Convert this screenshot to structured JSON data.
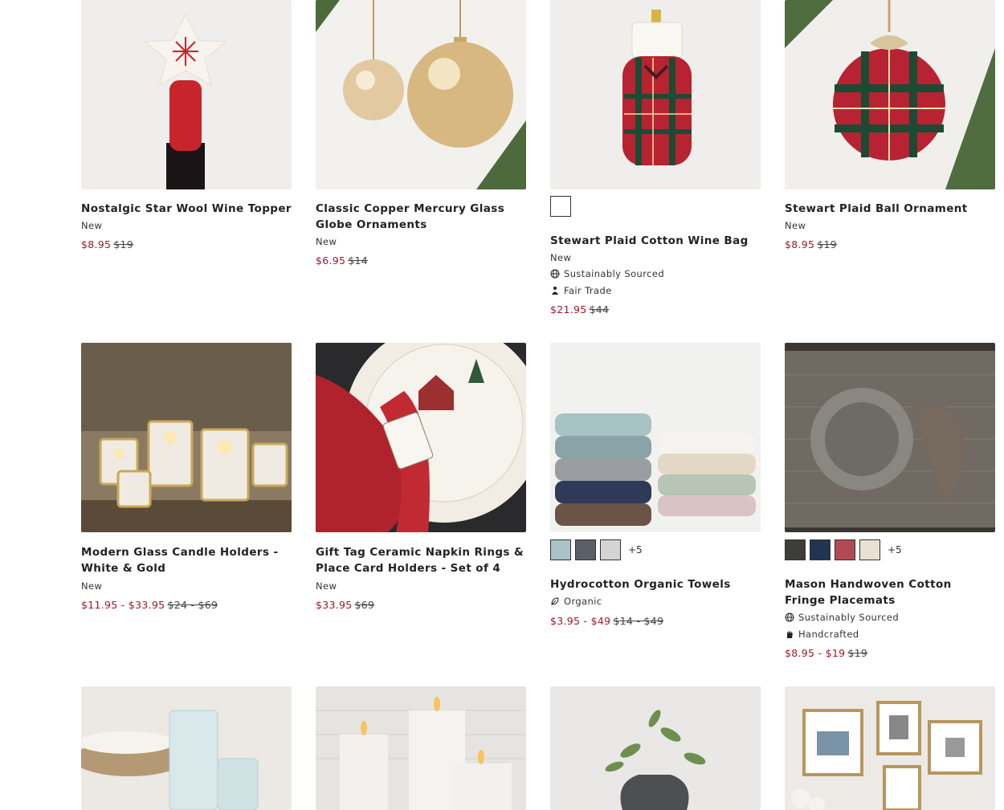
{
  "products": [
    {
      "title": "Nostalgic Star Wool Wine Topper",
      "badge": "New",
      "sale_price": "$8.95",
      "orig_price": "$19",
      "image_icon": "wine-topper-image"
    },
    {
      "title": "Classic Copper Mercury Glass Globe Ornaments",
      "badge": "New",
      "sale_price": "$6.95",
      "orig_price": "$14",
      "image_icon": "ornaments-image"
    },
    {
      "title": "Stewart Plaid Cotton Wine Bag",
      "badge": "New",
      "attr1": "Sustainably Sourced",
      "attr2": "Fair Trade",
      "sale_price": "$21.95",
      "orig_price": "$44",
      "image_icon": "wine-bag-image"
    },
    {
      "title": "Stewart Plaid Ball Ornament",
      "badge": "New",
      "sale_price": "$8.95",
      "orig_price": "$19",
      "image_icon": "ball-ornament-image"
    },
    {
      "title": "Modern Glass Candle Holders - White & Gold",
      "badge": "New",
      "sale_price": "$11.95 - $33.95",
      "orig_price": "$24 - $69",
      "image_icon": "candle-holders-image"
    },
    {
      "title": "Gift Tag Ceramic Napkin Rings & Place Card Holders - Set of 4",
      "badge": "New",
      "sale_price": "$33.95",
      "orig_price": "$69",
      "image_icon": "napkin-rings-image"
    },
    {
      "title": "Hydrocotton Organic Towels",
      "attr1": "Organic",
      "sale_price": "$3.95 - $49",
      "orig_price": "$14 - $49",
      "swatches": [
        "#a9c3c8",
        "#5b6068",
        "#d4d4d4"
      ],
      "more_swatches": "+5",
      "image_icon": "towels-image"
    },
    {
      "title": "Mason Handwoven Cotton Fringe Placemats",
      "attr1": "Sustainably Sourced",
      "attr2": "Handcrafted",
      "sale_price": "$8.95 - $19",
      "orig_price": "$19",
      "swatches": [
        "#3d3d3a",
        "#1f3552",
        "#b24a52",
        "#e8e2d4"
      ],
      "more_swatches": "+5",
      "image_icon": "placemats-image"
    }
  ],
  "wine_bag_swatch": "#ffffff",
  "bottom_row": [
    {
      "image_icon": "glassware-image"
    },
    {
      "image_icon": "led-candles-image"
    },
    {
      "image_icon": "vase-greenery-image"
    },
    {
      "image_icon": "frames-image"
    }
  ],
  "colors": {
    "sale": "#a3162b",
    "text": "#222222"
  }
}
